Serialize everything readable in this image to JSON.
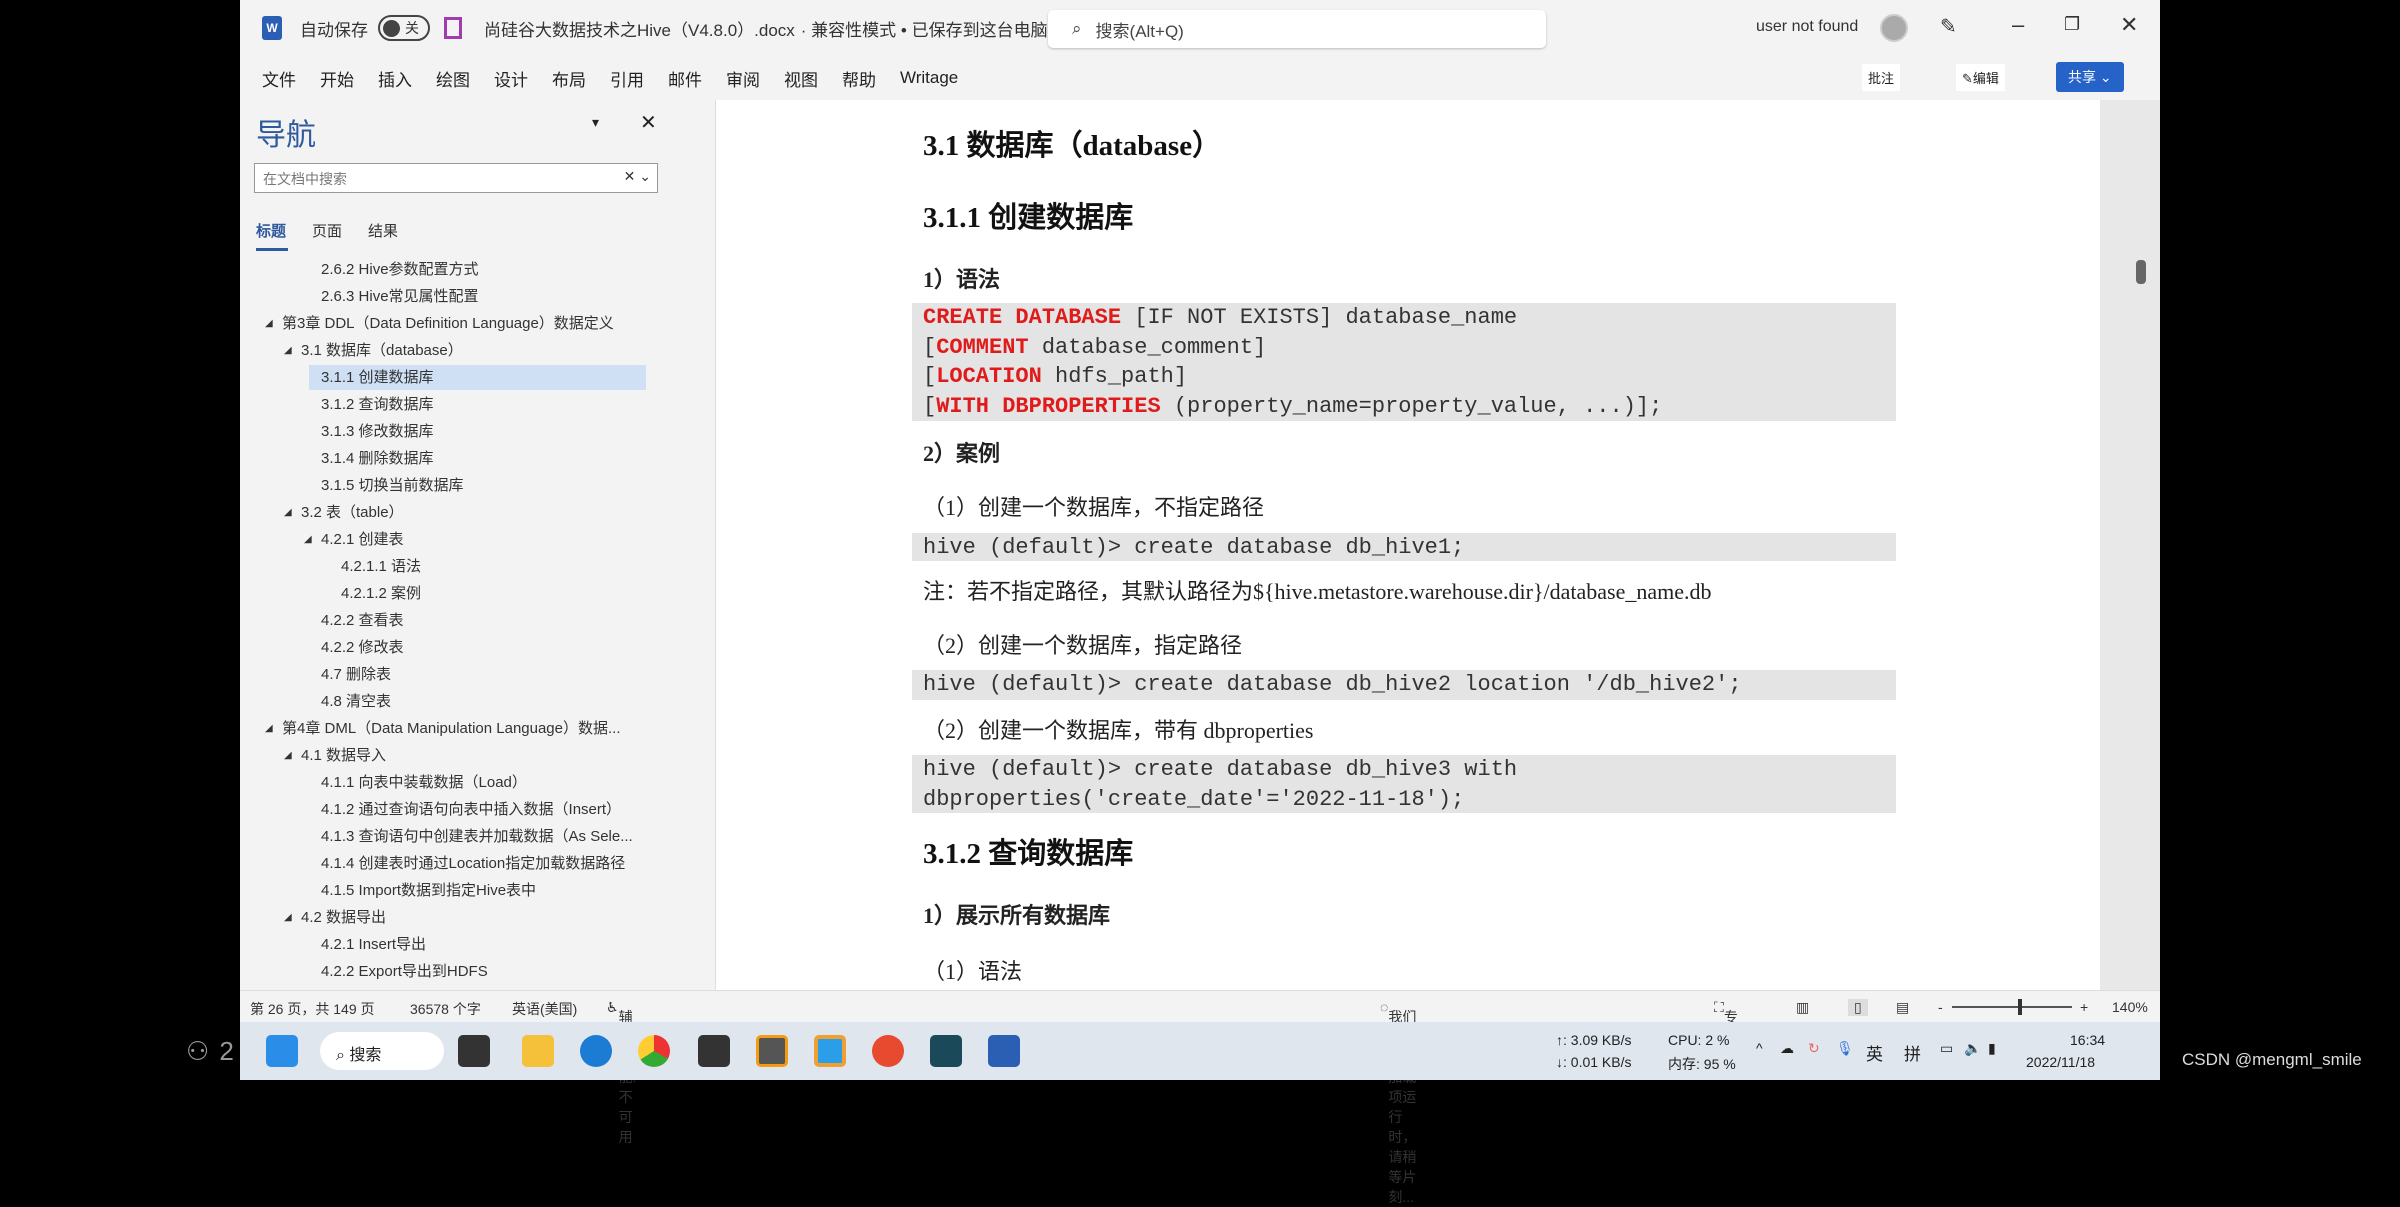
{
  "overlay": {
    "viewer_count": "2",
    "watermark": "CSDN @mengml_smile"
  },
  "titlebar": {
    "autosave_label": "自动保存",
    "autosave_state": "关",
    "doc_title": "尚硅谷大数据技术之Hive（V4.8.0）.docx",
    "doc_status": "· 兼容性模式 • 已保存到这台电脑",
    "search_placeholder": "搜索(Alt+Q)",
    "user": "user not found",
    "share_label": "共享",
    "edit_label": "编辑",
    "comment_label": "批注"
  },
  "ribbon": {
    "tabs": [
      "文件",
      "开始",
      "插入",
      "绘图",
      "设计",
      "布局",
      "引用",
      "邮件",
      "审阅",
      "视图",
      "帮助",
      "Writage"
    ]
  },
  "nav": {
    "title": "导航",
    "search_placeholder": "在文档中搜索",
    "tabs": [
      "标题",
      "页面",
      "结果"
    ],
    "items": [
      {
        "label": "2.6.2 Hive参数配置方式",
        "level": 3
      },
      {
        "label": "2.6.3 Hive常见属性配置",
        "level": 3
      },
      {
        "label": "第3章 DDL（Data Definition Language）数据定义",
        "level": 1,
        "expanded": true
      },
      {
        "label": "3.1 数据库（database）",
        "level": 2,
        "expanded": true
      },
      {
        "label": "3.1.1 创建数据库",
        "level": 3,
        "selected": true
      },
      {
        "label": "3.1.2 查询数据库",
        "level": 3
      },
      {
        "label": "3.1.3 修改数据库",
        "level": 3
      },
      {
        "label": "3.1.4 删除数据库",
        "level": 3
      },
      {
        "label": "3.1.5 切换当前数据库",
        "level": 3
      },
      {
        "label": "3.2 表（table）",
        "level": 2,
        "expanded": true
      },
      {
        "label": "4.2.1 创建表",
        "level": 3,
        "expanded": true
      },
      {
        "label": "4.2.1.1 语法",
        "level": 4
      },
      {
        "label": "4.2.1.2 案例",
        "level": 4
      },
      {
        "label": "4.2.2 查看表",
        "level": 3
      },
      {
        "label": "4.2.2 修改表",
        "level": 3
      },
      {
        "label": "4.7 删除表",
        "level": 3
      },
      {
        "label": "4.8 清空表",
        "level": 3
      },
      {
        "label": "第4章 DML（Data Manipulation Language）数据...",
        "level": 1,
        "expanded": true
      },
      {
        "label": "4.1 数据导入",
        "level": 2,
        "expanded": true
      },
      {
        "label": "4.1.1 向表中装载数据（Load）",
        "level": 3
      },
      {
        "label": "4.1.2 通过查询语句向表中插入数据（Insert）",
        "level": 3
      },
      {
        "label": "4.1.3 查询语句中创建表并加载数据（As Sele...",
        "level": 3
      },
      {
        "label": "4.1.4 创建表时通过Location指定加载数据路径",
        "level": 3
      },
      {
        "label": "4.1.5 Import数据到指定Hive表中",
        "level": 3
      },
      {
        "label": "4.2 数据导出",
        "level": 2,
        "expanded": true
      },
      {
        "label": "4.2.1 Insert导出",
        "level": 3
      },
      {
        "label": "4.2.2 Export导出到HDFS",
        "level": 3
      }
    ]
  },
  "doc": {
    "h2": "3.1 数据库（database）",
    "h3": "3.1.1 创建数据库",
    "syntax_label": "1）语法",
    "syntax": {
      "l1_kw": "CREATE DATABASE",
      "l1": " [IF NOT EXISTS] database_name",
      "l2_kw": "COMMENT",
      "l2": " database_comment]",
      "l3_kw": "LOCATION",
      "l3": " hdfs_path]",
      "l4_kw": "WITH DBPROPERTIES",
      "l4": " (property_name=property_value, ...)];"
    },
    "case_label": "2）案例",
    "c1": "（1）创建一个数据库，不指定路径",
    "code1": "hive (default)> create database db_hive1;",
    "note": "注：若不指定路径，其默认路径为${hive.metastore.warehouse.dir}/database_name.db",
    "c2": "（2）创建一个数据库，指定路径",
    "code2": "hive (default)> create database db_hive2 location '/db_hive2';",
    "c3": "（2）创建一个数据库，带有 dbproperties",
    "code3": "hive (default)> create database db_hive3 with\ndbproperties('create_date'='2022-11-18');",
    "h3b": "3.1.2 查询数据库",
    "show_label": "1）展示所有数据库",
    "syntax2_label": "（1）语法"
  },
  "status": {
    "page": "第 26 页，共 149 页",
    "words": "36578 个字",
    "lang": "英语(美国)",
    "accessibility": "辅助功能: 不可用",
    "loading": "我们正在启动加载项运行时，请稍等片刻...",
    "focus": "专注",
    "zoom": "140%",
    "zoom_percent": 140
  },
  "taskbar": {
    "search": "搜索",
    "net_up": "↑: 3.09 KB/s",
    "net_down": "↓: 0.01 KB/s",
    "cpu": "CPU: 2 %",
    "mem": "内存: 95 %",
    "ime1": "英",
    "ime2": "拼",
    "time": "16:34",
    "date": "2022/11/18"
  }
}
